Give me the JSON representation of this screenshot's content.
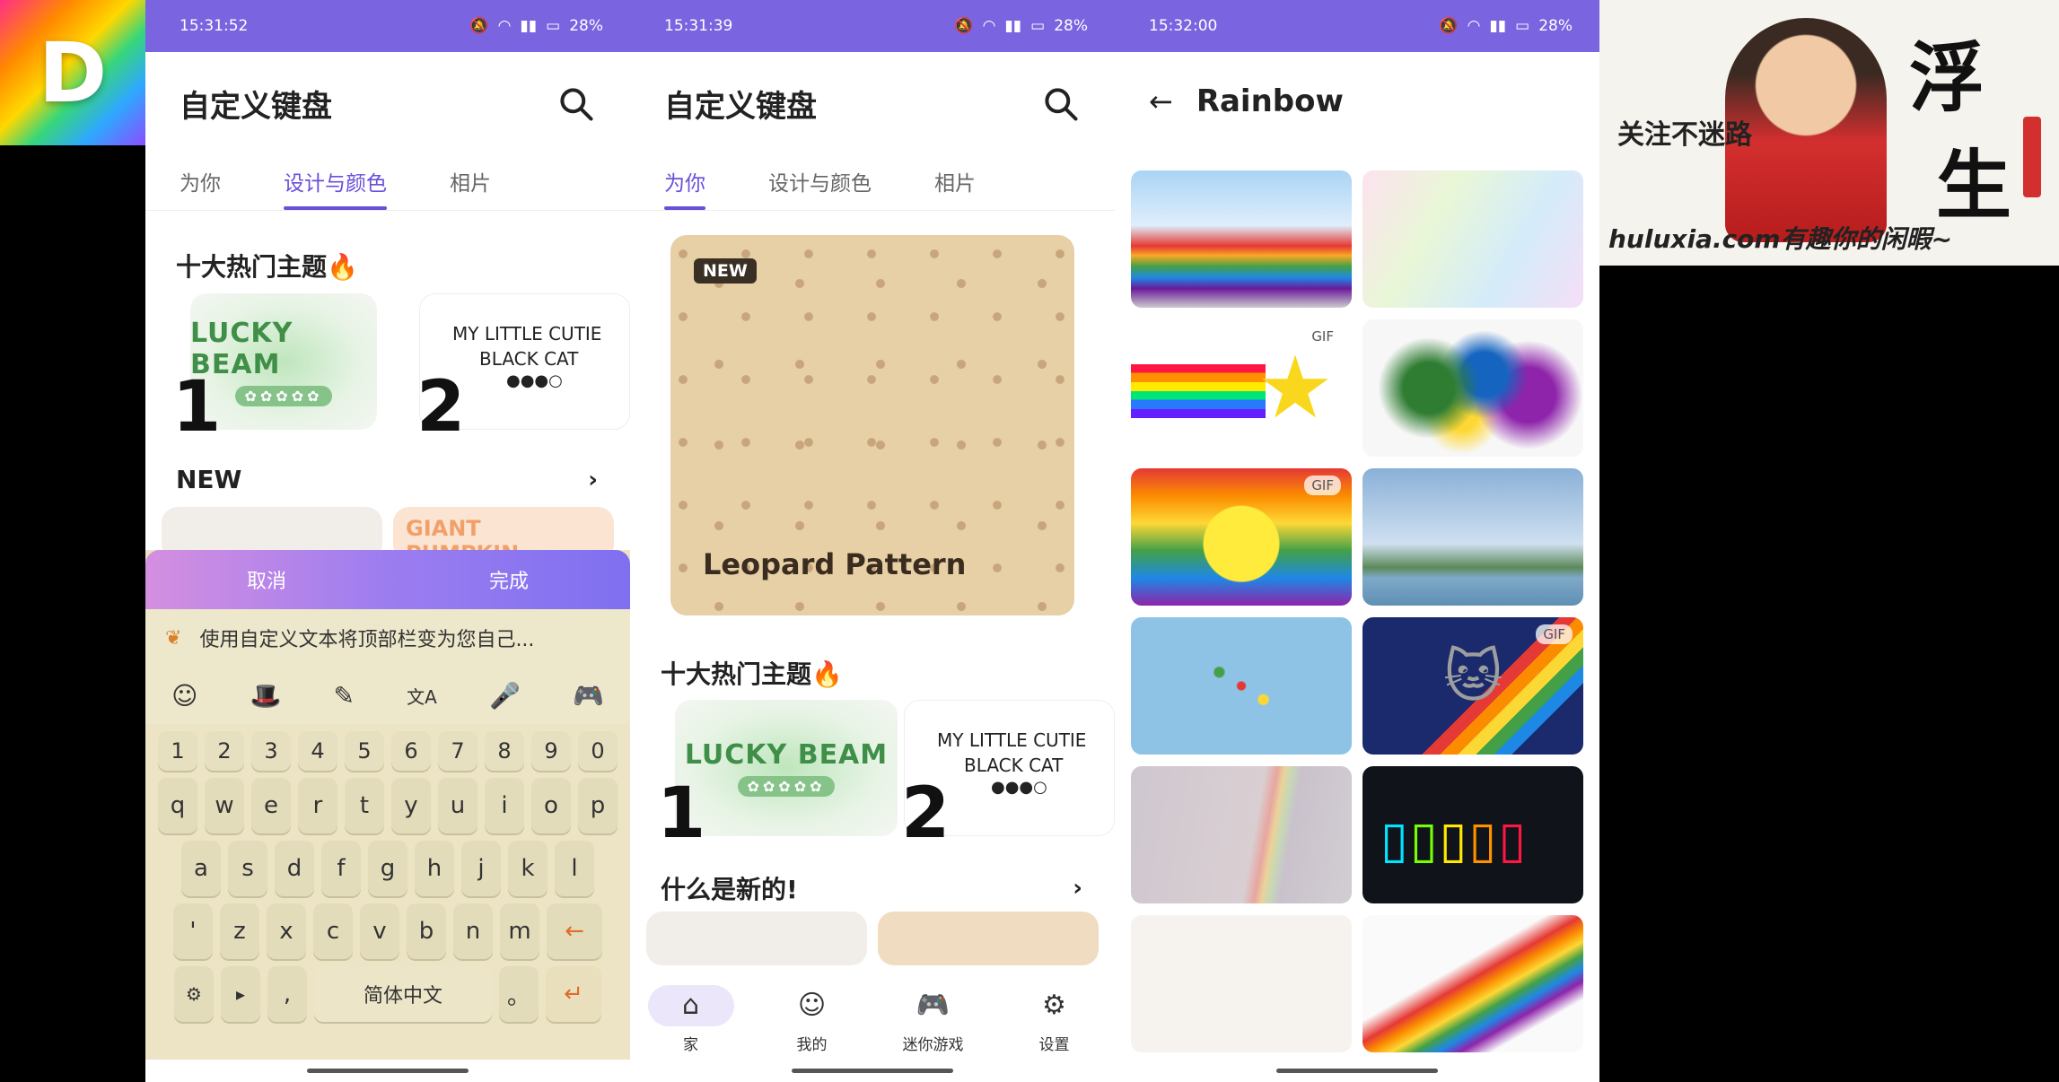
{
  "logo": {
    "letter": "D"
  },
  "phone1": {
    "status": {
      "time": "15:31:52",
      "battery": "28%"
    },
    "title": "自定义键盘",
    "tabs": [
      "为你",
      "设计与颜色",
      "相片"
    ],
    "section_top": "十大热门主题🔥",
    "rank1": "1",
    "rank2": "2",
    "lucky_title": "LUCKY BEAM",
    "cat_title_line1": "MY LITTLE CUTIE",
    "cat_title_line2": "BLACK CAT",
    "section_new": "NEW",
    "pumpkin": "GIANT PUMPKIN",
    "keyboard": {
      "cancel": "取消",
      "done": "完成",
      "suggestion": "使用自定义文本将顶部栏变为您自己...",
      "row_num": [
        "1",
        "2",
        "3",
        "4",
        "5",
        "6",
        "7",
        "8",
        "9",
        "0"
      ],
      "row1": [
        "q",
        "w",
        "e",
        "r",
        "t",
        "y",
        "u",
        "i",
        "o",
        "p"
      ],
      "row2": [
        "a",
        "s",
        "d",
        "f",
        "g",
        "h",
        "j",
        "k",
        "l"
      ],
      "row3": [
        "'",
        "z",
        "x",
        "c",
        "v",
        "b",
        "n",
        "m"
      ],
      "space": "简体中文",
      "comma": ",",
      "period": "。",
      "tool_icons": [
        "☺",
        "🎩",
        "✎",
        "文A",
        "🎤",
        "🎮"
      ]
    }
  },
  "phone2": {
    "status": {
      "time": "15:31:39",
      "battery": "28%"
    },
    "title": "自定义键盘",
    "tabs": [
      "为你",
      "设计与颜色",
      "相片"
    ],
    "badge_new": "NEW",
    "featured": "Leopard Pattern",
    "section_top": "十大热门主题🔥",
    "rank1": "1",
    "rank2": "2",
    "lucky_title": "LUCKY BEAM",
    "cat_title_line1": "MY LITTLE CUTIE",
    "cat_title_line2": "BLACK CAT",
    "section_new": "什么是新的!",
    "nav": [
      {
        "label": "家",
        "icon": "home-icon"
      },
      {
        "label": "我的",
        "icon": "person-icon"
      },
      {
        "label": "迷你游戏",
        "icon": "gamepad-icon"
      },
      {
        "label": "设置",
        "icon": "gear-icon"
      }
    ]
  },
  "phone3": {
    "status": {
      "time": "15:32:00",
      "battery": "28%"
    },
    "title": "Rainbow",
    "gif": "GIF"
  },
  "banner": {
    "follow": "关注不迷路",
    "site": "huluxia.com有趣你的闲暇~",
    "big1": "浮",
    "big2": "生"
  }
}
